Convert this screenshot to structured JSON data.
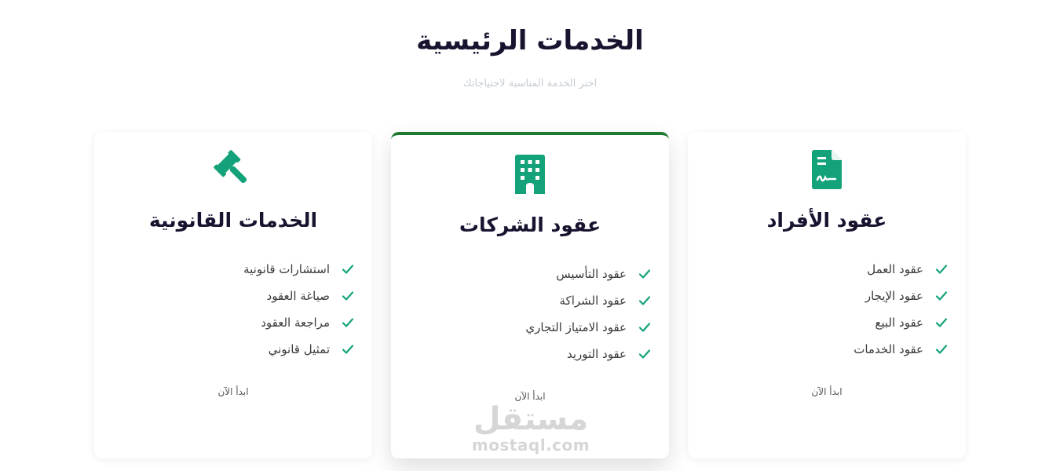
{
  "header": {
    "title": "الخدمات الرئيسية",
    "subtitle": "اختر الخدمة المناسبة لاحتياجاتك"
  },
  "colors": {
    "accent": "#13a27a",
    "featured_border": "#1f7a2e",
    "title_text": "#1a1330"
  },
  "cards": [
    {
      "icon": "contract-document-icon",
      "title": "عقود الأفراد",
      "items": [
        "عقود العمل",
        "عقود الإيجار",
        "عقود البيع",
        "عقود الخدمات"
      ],
      "cta": "ابدأ الآن"
    },
    {
      "icon": "building-icon",
      "title": "عقود الشركات",
      "items": [
        "عقود التأسيس",
        "عقود الشراكة",
        "عقود الامتياز التجاري",
        "عقود التوريد"
      ],
      "cta": "ابدأ الآن",
      "featured": true
    },
    {
      "icon": "gavel-icon",
      "title": "الخدمات القانونية",
      "items": [
        "استشارات قانونية",
        "صياغة العقود",
        "مراجعة العقود",
        "تمثيل قانوني"
      ],
      "cta": "ابدأ الآن"
    }
  ],
  "watermark": {
    "logo": "مستقل",
    "url": "mostaql.com"
  }
}
